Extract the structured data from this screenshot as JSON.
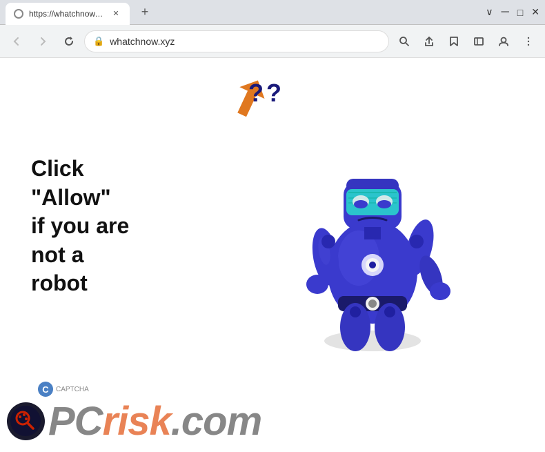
{
  "browser": {
    "url": "https://whatchnow.xyz",
    "url_display": "whatchnow.xyz",
    "tab_title": "https://whatchnow.xyz",
    "tab_favicon_alt": "page icon"
  },
  "toolbar": {
    "back_label": "←",
    "forward_label": "→",
    "reload_label": "✕",
    "lock_icon": "🔒"
  },
  "toolbar_right": {
    "search_label": "⌕",
    "share_label": "↑",
    "bookmark_label": "☆",
    "sidebar_label": "▭",
    "profile_label": "○",
    "menu_label": "⋮"
  },
  "titlebar_controls": {
    "min": "─",
    "max": "□",
    "close": "✕"
  },
  "page": {
    "main_text": "Click\n\"Allow\"\nif you are\nnot a\nrobot",
    "captcha_text": "CAPTCHA",
    "watermark_pc": "PC",
    "watermark_risk": "risk",
    "watermark_domain": ".com"
  },
  "arrow": {
    "color": "#e07020"
  }
}
